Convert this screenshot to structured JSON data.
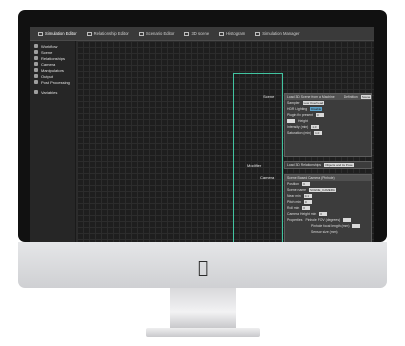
{
  "tabs": [
    {
      "label": "Simulation Editor"
    },
    {
      "label": "Relationship Editor"
    },
    {
      "label": "Scenario Editor"
    },
    {
      "label": "3D scene"
    },
    {
      "label": "Histogram"
    },
    {
      "label": "Simulation Manager"
    }
  ],
  "sidebar": {
    "items": [
      {
        "label": "Workflow"
      },
      {
        "label": "Scene"
      },
      {
        "label": "Relationships"
      },
      {
        "label": "Camera"
      },
      {
        "label": "Manipulators"
      },
      {
        "label": "Output"
      },
      {
        "label": "Post Processing"
      },
      {
        "label": "Variables"
      }
    ]
  },
  "nodes": {
    "scene_label": "Scene",
    "modifier_label": "Modifier",
    "camera_label": "Camera"
  },
  "panel_top": {
    "title": "Load 3D Scene from a Machine",
    "extra_label": "Definition",
    "extra_value": "Scene",
    "rows": [
      {
        "label": "Sampler",
        "value": "Low Overhead"
      },
      {
        "label": "HDR Lighting",
        "value": "Disable"
      },
      {
        "label": "Plugin fix present",
        "value": "0"
      },
      {
        "label": "Height",
        "value": ""
      },
      {
        "label": "Intensity (min)",
        "value": "1.0"
      },
      {
        "label": "Saturation (min)",
        "value": "1.0"
      }
    ]
  },
  "panel_modifier": {
    "title": "Load 3D Relationships",
    "value": "Objects and its Pose"
  },
  "panel_camera": {
    "title": "Scene Based Camera (Pinhole)",
    "rows": [
      {
        "label": "Position",
        "value": "0"
      },
      {
        "label": "Scene name",
        "value": "SCENE_CAMERA"
      },
      {
        "label": "Near min",
        "value": "0.1"
      },
      {
        "label": "Pitch min",
        "value": "0"
      },
      {
        "label": "Roll min",
        "value": "0"
      },
      {
        "label": "Camera Height min",
        "value": "0"
      },
      {
        "label": "Properties",
        "value": "Pinhole FOV (degrees)"
      },
      {
        "label": "",
        "value": "Pinhole focal length (mm)"
      },
      {
        "label": "",
        "value": "Sensor size (mm)"
      }
    ]
  },
  "colors": {
    "accent": "#41c3a0",
    "field_blue": "#5aa0c8"
  }
}
